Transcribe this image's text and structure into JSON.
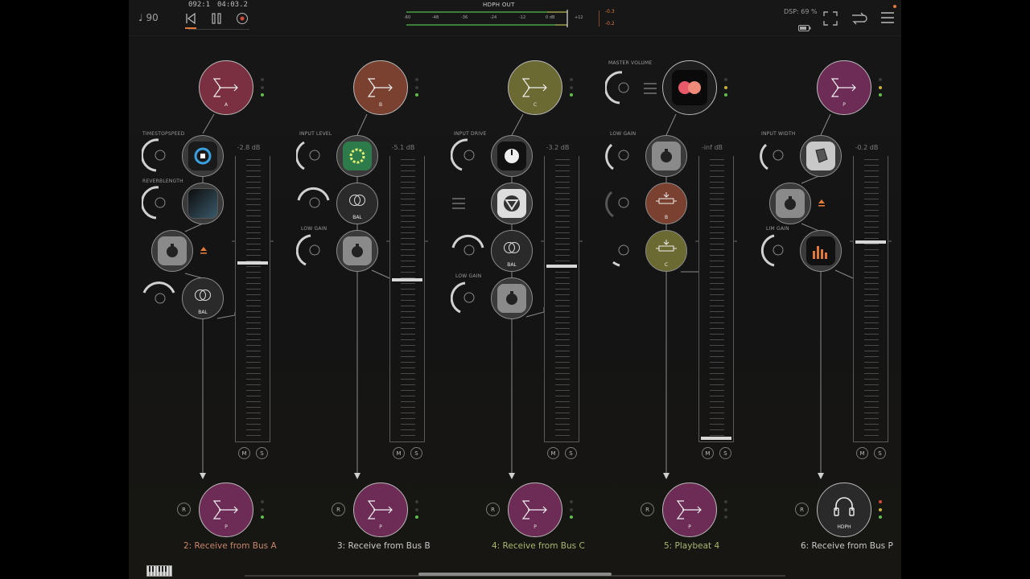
{
  "topbar": {
    "tempo": "♩ 90",
    "bar_position": "092:1",
    "time_position": "04:03.2",
    "meter_title": "HDPH OUT",
    "meter_ticks": [
      "-60",
      "-48",
      "-36",
      "-24",
      "-12",
      "0 dB",
      "+12"
    ],
    "meter_peak_top": "-0.3",
    "meter_peak_bottom": "-0.2",
    "dsp": "DSP: 69 %"
  },
  "strips": [
    {
      "bus_letter": "A",
      "bus_color": "#7a3040",
      "labels": [
        "TIMESTOPSPEED",
        "REVERBLENGTH"
      ],
      "plugins": [
        "",
        "",
        "",
        "BAL"
      ],
      "db": "-2.8 dB",
      "fader_level_db": -2.8,
      "out_letter": "P",
      "name": "2: Receive from Bus A",
      "name_color": "#c8866a"
    },
    {
      "bus_letter": "B",
      "bus_color": "#7a4030",
      "labels": [
        "INPUT LEVEL",
        "LOW GAIN"
      ],
      "plugins": [
        "",
        "BAL",
        ""
      ],
      "db": "-5.1 dB",
      "fader_level_db": -5.1,
      "out_letter": "P",
      "name": "3: Receive from Bus B",
      "name_color": "#c9c9c9"
    },
    {
      "bus_letter": "C",
      "bus_color": "#6b6a32",
      "labels": [
        "INPUT DRIVE",
        "LOW GAIN"
      ],
      "plugins": [
        "",
        "",
        "BAL",
        ""
      ],
      "db": "-3.2 dB",
      "fader_level_db": -3.2,
      "out_letter": "P",
      "name": "4: Receive from Bus C",
      "name_color": "#a9b86a"
    },
    {
      "bus_letter": "",
      "bus_color": "#1e1e1e",
      "labels": [
        "MASTER VOLUME",
        "LOW GAIN"
      ],
      "plugins": [
        "",
        "B",
        "C"
      ],
      "db": "-inf dB",
      "fader_level_db": null,
      "out_letter": "P",
      "name": "5: Playbeat 4",
      "name_color": "#a9b86a"
    },
    {
      "bus_letter": "P",
      "bus_color": "#6c2c55",
      "labels": [
        "INPUT WIDTH",
        "LIM GAIN"
      ],
      "plugins": [
        "",
        "",
        ""
      ],
      "db": "-0.2 dB",
      "fader_level_db": -0.2,
      "out_letter": "HDPH",
      "name": "6: Receive from Bus P",
      "name_color": "#c9c9c9"
    }
  ],
  "buttons": {
    "mute": "M",
    "solo": "S",
    "record": "R"
  },
  "colors": {
    "accent_orange": "#e07a3a",
    "led_green": "#5ec04a",
    "led_red": "#d24a3a",
    "out_bus": "#6c2c55"
  }
}
